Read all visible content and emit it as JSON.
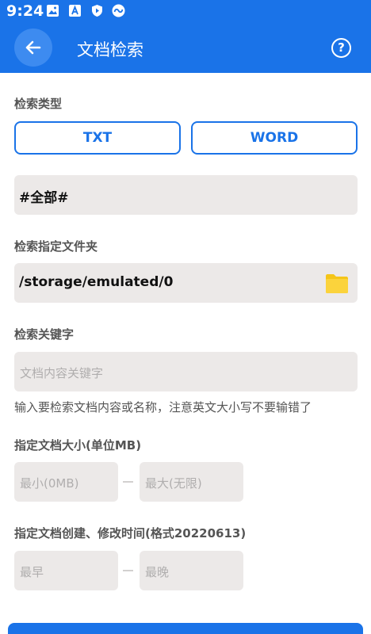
{
  "status_bar": {
    "time": "9:24",
    "icons": [
      "image-icon",
      "font-icon",
      "shield-icon",
      "app-icon"
    ]
  },
  "app_bar": {
    "title": "文档检索"
  },
  "search_type": {
    "label": "检索类型",
    "options": [
      {
        "label": "TXT"
      },
      {
        "label": "WORD"
      }
    ]
  },
  "selected_type": "#全部#",
  "folder": {
    "label": "检索指定文件夹",
    "path": "/storage/emulated/0"
  },
  "keyword": {
    "label": "检索关键字",
    "placeholder": "文档内容关键字",
    "hint": "输入要检索文档内容或名称，注意英文大小写不要输错了"
  },
  "size": {
    "label": "指定文档大小(单位MB)",
    "min_placeholder": "最小(0MB)",
    "max_placeholder": "最大(无限)"
  },
  "time": {
    "label": "指定文档创建、修改时间(格式20220613)",
    "earliest_placeholder": "最早",
    "latest_placeholder": "最晚"
  },
  "colors": {
    "accent": "#1a73e8",
    "field_bg": "#ece9e8",
    "folder": "#f5c518"
  }
}
